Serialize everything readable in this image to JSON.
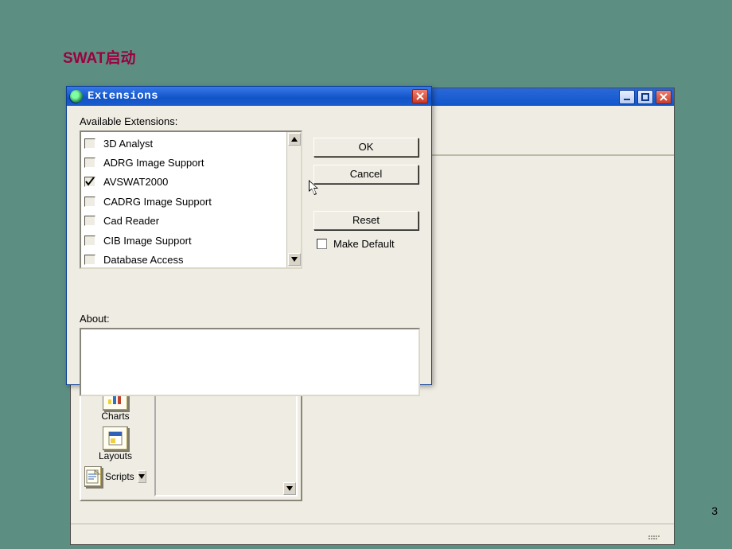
{
  "slide": {
    "title": "SWAT启动",
    "page": "3"
  },
  "arcview": {
    "window_buttons": {
      "min": "–",
      "max": "□",
      "close": "×"
    },
    "palette": {
      "item1_label": "Charts",
      "item2_label": "Layouts",
      "item3_label": "Scripts"
    }
  },
  "dialog": {
    "title": "Extensions",
    "available_label": "Available Extensions:",
    "about_label": "About:",
    "buttons": {
      "ok": "OK",
      "cancel": "Cancel",
      "reset": "Reset"
    },
    "make_default_label": "Make Default",
    "items": [
      {
        "label": "3D Analyst",
        "checked": false
      },
      {
        "label": "ADRG Image Support",
        "checked": false
      },
      {
        "label": "AVSWAT2000",
        "checked": true
      },
      {
        "label": "CADRG Image Support",
        "checked": false
      },
      {
        "label": "Cad Reader",
        "checked": false
      },
      {
        "label": "CIB Image Support",
        "checked": false
      },
      {
        "label": "Database Access",
        "checked": false
      }
    ]
  }
}
